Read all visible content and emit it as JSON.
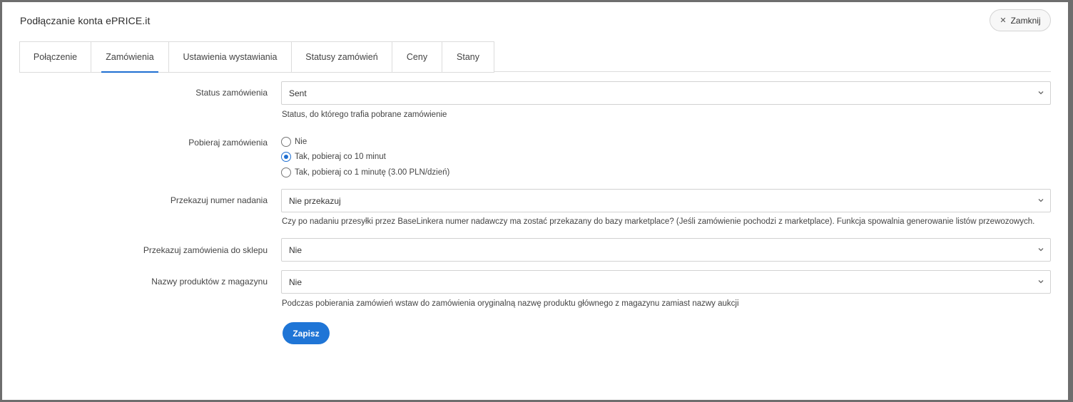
{
  "modal": {
    "title": "Podłączanie konta ePRICE.it",
    "close_label": "Zamknij"
  },
  "tabs": [
    {
      "label": "Połączenie",
      "active": false
    },
    {
      "label": "Zamówienia",
      "active": true
    },
    {
      "label": "Ustawienia wystawiania",
      "active": false
    },
    {
      "label": "Statusy zamówień",
      "active": false
    },
    {
      "label": "Ceny",
      "active": false
    },
    {
      "label": "Stany",
      "active": false
    }
  ],
  "form": {
    "order_status": {
      "label": "Status zamówienia",
      "value": "Sent",
      "help": "Status, do którego trafia pobrane zamówienie"
    },
    "fetch_orders": {
      "label": "Pobieraj zamówienia",
      "options": [
        {
          "label": "Nie",
          "checked": false
        },
        {
          "label": "Tak, pobieraj co 10 minut",
          "checked": true
        },
        {
          "label": "Tak, pobieraj co 1 minutę (3.00 PLN/dzień)",
          "checked": false
        }
      ]
    },
    "tracking_number": {
      "label": "Przekazuj numer nadania",
      "value": "Nie przekazuj",
      "help": "Czy po nadaniu przesyłki przez BaseLinkera numer nadawczy ma zostać przekazany do bazy marketplace? (Jeśli zamówienie pochodzi z marketplace). Funkcja spowalnia generowanie listów przewozowych."
    },
    "forward_orders": {
      "label": "Przekazuj zamówienia do sklepu",
      "value": "Nie"
    },
    "product_names": {
      "label": "Nazwy produktów z magazynu",
      "value": "Nie",
      "help": "Podczas pobierania zamówień wstaw do zamówienia oryginalną nazwę produktu głównego z magazynu zamiast nazwy aukcji"
    },
    "save_label": "Zapisz"
  },
  "colors": {
    "accent": "#1f75d6",
    "backdrop": "#6e6e6e"
  }
}
